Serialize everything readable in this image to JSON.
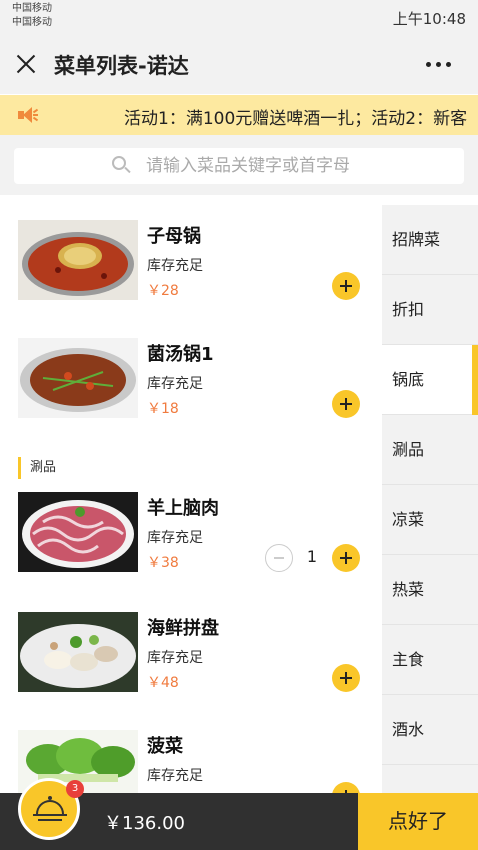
{
  "status_bar": {
    "carrier_1": "中国移动",
    "carrier_2": "中国移动",
    "time": "上午10:48"
  },
  "title_bar": {
    "close_icon": "close-icon",
    "title": "菜单列表-诺达",
    "more_icon": "more-icon"
  },
  "announcement": {
    "icon": "speaker-icon",
    "text": "活动1：满100元赠送啤酒一扎；活动2：新客"
  },
  "search": {
    "placeholder": "请输入菜品关键字或首字母",
    "value": ""
  },
  "dishes": [
    {
      "name": "子母锅",
      "stock": "库存充足",
      "price": "￥28",
      "quantity": null
    },
    {
      "name": "菌汤锅1",
      "stock": "库存充足",
      "price": "￥18",
      "quantity": null
    },
    {
      "name": "羊上脑肉",
      "stock": "库存充足",
      "price": "￥38",
      "quantity": "1"
    },
    {
      "name": "海鲜拼盘",
      "stock": "库存充足",
      "price": "￥48",
      "quantity": null
    },
    {
      "name": "菠菜",
      "stock": "库存充足",
      "price": "",
      "quantity": null
    }
  ],
  "section_label": "涮品",
  "categories": [
    {
      "label": "招牌菜",
      "active": false
    },
    {
      "label": "折扣",
      "active": false
    },
    {
      "label": "锅底",
      "active": true
    },
    {
      "label": "涮品",
      "active": false
    },
    {
      "label": "凉菜",
      "active": false
    },
    {
      "label": "热菜",
      "active": false
    },
    {
      "label": "主食",
      "active": false
    },
    {
      "label": "酒水",
      "active": false
    }
  ],
  "cart": {
    "icon": "cloche-icon",
    "badge": "3",
    "total": "￥136.00",
    "checkout_label": "点好了"
  },
  "colors": {
    "accent": "#f9c629",
    "price": "#f07b3f",
    "banner_bg": "#fde9a0",
    "cart_bar": "#303030",
    "badge": "#e8403a"
  }
}
